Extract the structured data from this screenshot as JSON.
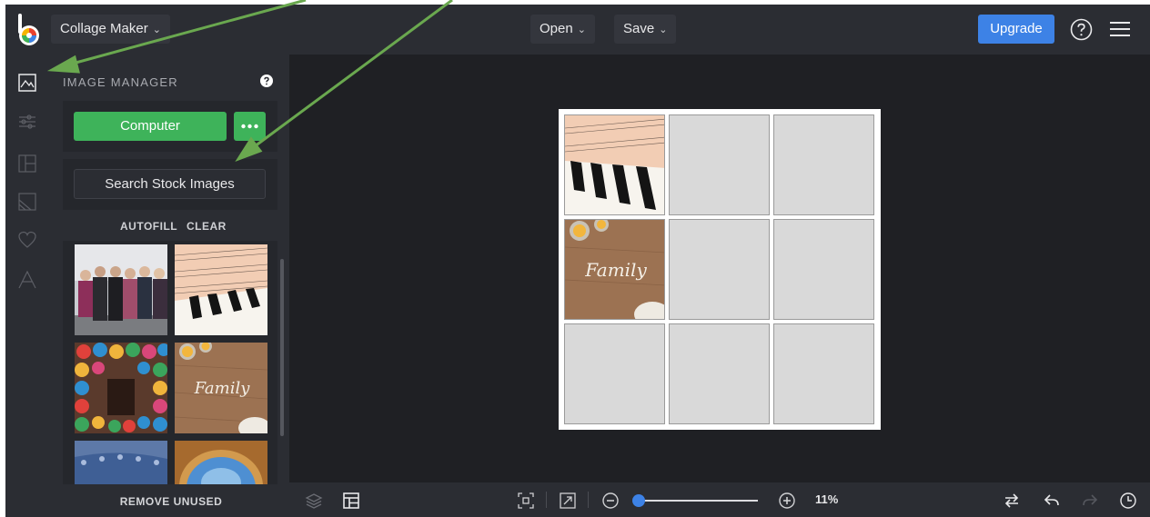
{
  "app": {
    "mode_label": "Collage Maker",
    "open_label": "Open",
    "save_label": "Save",
    "upgrade_label": "Upgrade"
  },
  "panel": {
    "title": "IMAGE MANAGER",
    "computer_label": "Computer",
    "stock_label": "Search Stock Images",
    "autofill_label": "AUTOFILL",
    "clear_label": "CLEAR",
    "remove_unused_label": "REMOVE UNUSED",
    "thumbnails": [
      "group-photo",
      "sheet-music-piano",
      "colorful-bowls",
      "family-flour",
      "blue-mosaic",
      "arch-sky"
    ]
  },
  "rail": {
    "tools": [
      "image-manager-icon",
      "adjust-icon",
      "layout-icon",
      "background-icon",
      "favorites-icon",
      "text-icon"
    ]
  },
  "canvas": {
    "grid": "3x3",
    "filled_cells": [
      "sheet-music-piano",
      "family-flour"
    ]
  },
  "zoom": {
    "value_label": "11%",
    "level": 0.11
  },
  "colors": {
    "accent_blue": "#3d82e6",
    "accent_green": "#3eb35a",
    "annotation_arrow": "#6aa84f",
    "background": "#1f2024",
    "panel": "#2b2d33"
  }
}
